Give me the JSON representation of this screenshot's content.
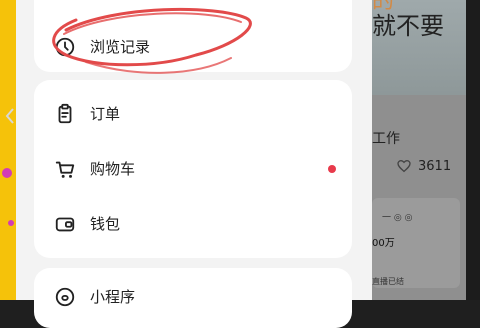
{
  "drawer": {
    "history_label": "浏览记录",
    "orders_label": "订单",
    "cart_label": "购物车",
    "wallet_label": "钱包",
    "mini_program_label": "小程序"
  },
  "feed": {
    "top_title": "的",
    "big_text": "就不要",
    "work_text": "工作",
    "like_count": "3611",
    "mini_text": "一 ◎ ◎",
    "mini_amount": "00万",
    "mini_footer": "直播已结"
  },
  "colors": {
    "left_bg": "#f5c20a",
    "drawer_bg": "#f3f3f3",
    "card_bg": "#ffffff",
    "badge": "#e83a4b",
    "scribble": "#e24a4a"
  }
}
